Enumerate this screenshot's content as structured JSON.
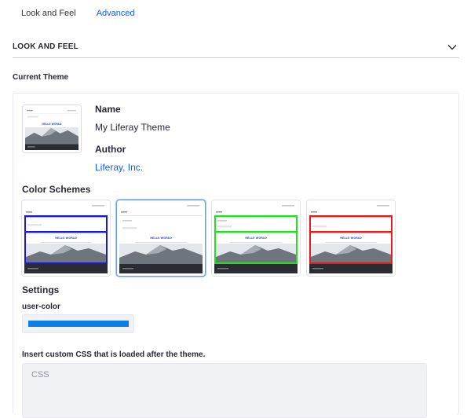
{
  "tabs": [
    {
      "label": "Look and Feel"
    },
    {
      "label": "Advanced"
    }
  ],
  "section": {
    "title": "LOOK AND FEEL",
    "icon": "chevron-down-icon"
  },
  "current_theme": {
    "label": "Current Theme",
    "name_label": "Name",
    "name_value": "My Liferay Theme",
    "author_label": "Author",
    "author_value": "Liferay, Inc.",
    "thumb_caption": "HELLO WORLD"
  },
  "color_schemes": {
    "label": "Color Schemes",
    "items": [
      {
        "accent": "#1a1ad6",
        "caption": "HELLO WORLD"
      },
      {
        "accent": "#e6e6e6",
        "caption": "HELLO WORLD",
        "selected": true
      },
      {
        "accent": "#22e01e",
        "caption": "HELLO WORLD"
      },
      {
        "accent": "#e31b1b",
        "caption": "HELLO WORLD"
      }
    ]
  },
  "settings": {
    "label": "Settings",
    "user_color_label": "user-color",
    "user_color_value": "#0b7ee8",
    "css_description": "Insert custom CSS that is loaded after the theme.",
    "css_placeholder": "CSS"
  }
}
